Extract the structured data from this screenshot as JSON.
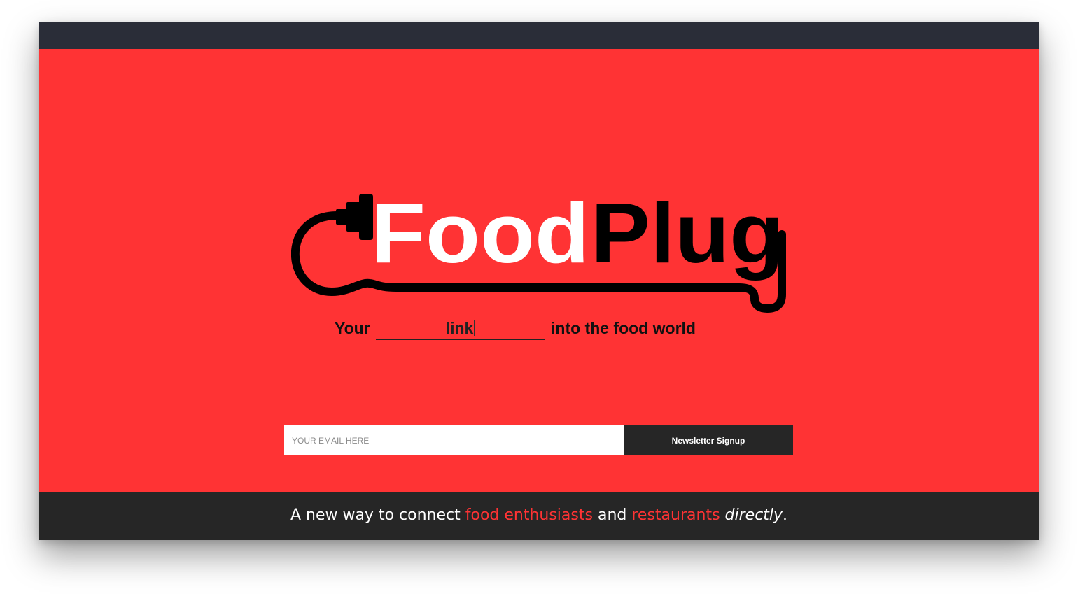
{
  "brand": {
    "logo_part1": "Food",
    "logo_part2": "Plug",
    "logo_icon": "plug-cable-icon",
    "colors": {
      "background_red": "#ff3334",
      "dark": "#262626",
      "topbar": "#2a2d38",
      "logo_white": "#ffffff",
      "logo_black": "#000000"
    }
  },
  "tagline": {
    "before": "Your",
    "blank_word": "link",
    "after": "into the food world"
  },
  "signup": {
    "email_placeholder": "YOUR EMAIL HERE",
    "email_value": "",
    "button_label": "Newsletter Signup"
  },
  "footer": {
    "part1": "A new way to connect",
    "highlight1": "food enthusiasts",
    "part2": "and",
    "highlight2": "restaurants",
    "emphasis": "directly",
    "end": "."
  }
}
